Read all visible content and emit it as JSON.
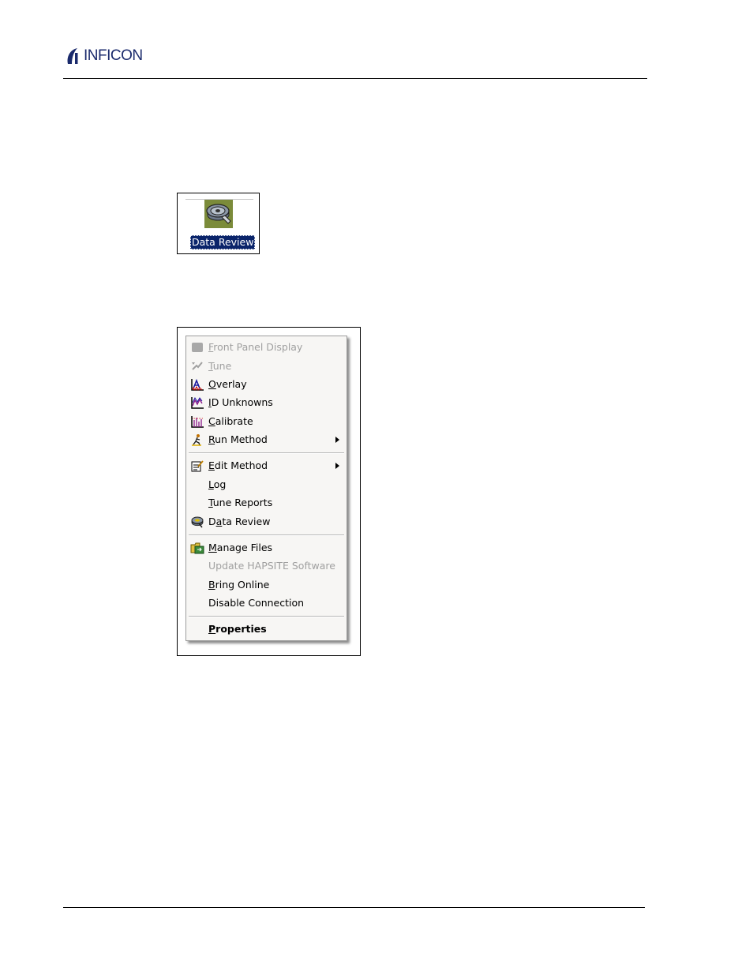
{
  "header": {
    "logo_text": "INFICON"
  },
  "desktop_icon": {
    "label": "Data Review",
    "icon": "data-review-reel-icon"
  },
  "context_menu": {
    "items": [
      {
        "label": "Front Panel Display",
        "mnemonic": "F",
        "rest": "ront Panel Display",
        "enabled": false,
        "icon": "front-panel-icon",
        "submenu": false
      },
      {
        "label": "Tune",
        "mnemonic": "T",
        "rest": "une",
        "enabled": false,
        "icon": "tune-icon",
        "submenu": false
      },
      {
        "label": "Overlay",
        "mnemonic": "O",
        "rest": "verlay",
        "enabled": true,
        "icon": "overlay-icon",
        "submenu": false
      },
      {
        "label": "ID Unknowns",
        "mnemonic": "I",
        "rest": "D Unknowns",
        "enabled": true,
        "icon": "id-unknowns-icon",
        "submenu": false
      },
      {
        "label": "Calibrate",
        "mnemonic": "C",
        "rest": "alibrate",
        "enabled": true,
        "icon": "calibrate-icon",
        "submenu": false
      },
      {
        "label": "Run Method",
        "mnemonic": "R",
        "rest": "un Method",
        "enabled": true,
        "icon": "run-method-icon",
        "submenu": true
      },
      {
        "label": "Edit Method",
        "mnemonic": "E",
        "rest": "dit Method",
        "enabled": true,
        "icon": "edit-method-icon",
        "submenu": true
      },
      {
        "label": "Log",
        "mnemonic": "L",
        "rest": "og",
        "enabled": true,
        "icon": "",
        "submenu": false
      },
      {
        "label": "Tune Reports",
        "mnemonic": "T",
        "rest": "une Reports",
        "enabled": true,
        "icon": "",
        "submenu": false
      },
      {
        "label": "Data Review",
        "pre": "D",
        "mnemonic": "a",
        "rest": "ta Review",
        "enabled": true,
        "icon": "data-review-icon",
        "submenu": false
      },
      {
        "label": "Manage Files",
        "mnemonic": "M",
        "rest": "anage Files",
        "enabled": true,
        "icon": "manage-files-icon",
        "submenu": false
      },
      {
        "label": "Update HAPSITE Software",
        "mnemonic": "",
        "rest": "Update HAPSITE Software",
        "enabled": false,
        "icon": "",
        "submenu": false
      },
      {
        "label": "Bring Online",
        "mnemonic": "B",
        "rest": "ring Online",
        "enabled": true,
        "icon": "",
        "submenu": false
      },
      {
        "label": "Disable Connection",
        "mnemonic": "",
        "rest": "Disable Connection",
        "enabled": true,
        "icon": "",
        "submenu": false
      },
      {
        "label": "Properties",
        "mnemonic": "P",
        "rest": "roperties",
        "enabled": true,
        "icon": "",
        "submenu": false
      }
    ]
  }
}
